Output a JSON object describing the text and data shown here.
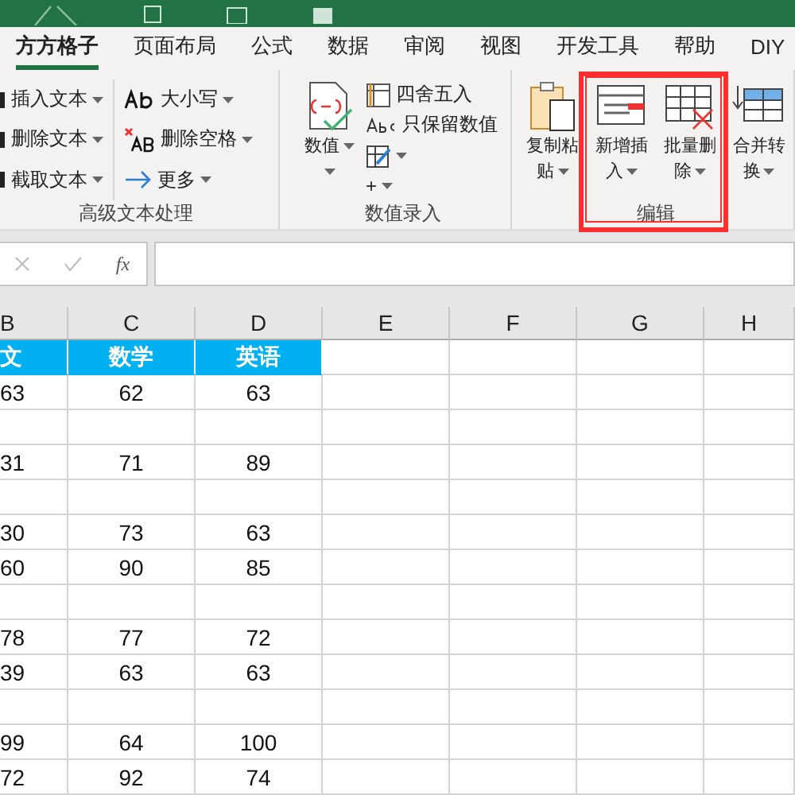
{
  "tabs": [
    {
      "label": "方方格子",
      "selected": true
    },
    {
      "label": "页面布局",
      "selected": false
    },
    {
      "label": "公式",
      "selected": false
    },
    {
      "label": "数据",
      "selected": false
    },
    {
      "label": "审阅",
      "selected": false
    },
    {
      "label": "视图",
      "selected": false
    },
    {
      "label": "开发工具",
      "selected": false
    },
    {
      "label": "帮助",
      "selected": false
    },
    {
      "label": "DIY",
      "selected": false
    }
  ],
  "ribbon": {
    "groups": [
      {
        "label": "高级文本处理",
        "columns": [
          [
            {
              "label": "插入文本",
              "kind": "cut"
            },
            {
              "label": "删除文本",
              "kind": "cut"
            },
            {
              "label": "截取文本",
              "kind": "cut"
            }
          ],
          [
            {
              "label": "大小写",
              "kind": "case"
            },
            {
              "label": "删除空格",
              "kind": "space"
            },
            {
              "label": "更多",
              "kind": "arrow"
            }
          ]
        ]
      },
      {
        "label": "数值录入",
        "large": [
          {
            "lines": [
              "数值"
            ],
            "kind": "value"
          }
        ],
        "columns": [
          [
            {
              "label": "四舍五入",
              "kind": "round",
              "dropdown": false
            },
            {
              "label": "只保留数值",
              "kind": "abc",
              "dropdown": false
            },
            {
              "kind": "gridpen",
              "dropdown": true
            },
            {
              "label": "+",
              "kind": "none",
              "dropdown": true
            }
          ]
        ]
      },
      {
        "label": "编辑",
        "large": [
          {
            "lines": [
              "复制粘",
              "贴"
            ],
            "kind": "paste"
          },
          {
            "lines": [
              "新增插",
              "入"
            ],
            "kind": "insert"
          },
          {
            "lines": [
              "批量删",
              "除"
            ],
            "kind": "delete"
          },
          {
            "lines": [
              "合并转",
              "换"
            ],
            "kind": "merge"
          }
        ]
      }
    ]
  },
  "formula_bar": {
    "function_label": "fx"
  },
  "sheet": {
    "columns": [
      "B",
      "C",
      "D",
      "E",
      "F",
      "G",
      "H"
    ],
    "rows": [
      {
        "kind": "header",
        "cells": [
          "文",
          "数学",
          "英语"
        ]
      },
      {
        "kind": "data",
        "cells": [
          "63",
          "62",
          "63"
        ]
      },
      {
        "kind": "data",
        "cells": []
      },
      {
        "kind": "data",
        "cells": [
          "31",
          "71",
          "89"
        ]
      },
      {
        "kind": "data",
        "cells": []
      },
      {
        "kind": "data",
        "cells": [
          "30",
          "73",
          "63"
        ]
      },
      {
        "kind": "data",
        "cells": [
          "60",
          "90",
          "85"
        ]
      },
      {
        "kind": "data",
        "cells": []
      },
      {
        "kind": "data",
        "cells": [
          "78",
          "77",
          "72"
        ]
      },
      {
        "kind": "data",
        "cells": [
          "39",
          "63",
          "63"
        ]
      },
      {
        "kind": "data",
        "cells": []
      },
      {
        "kind": "data",
        "cells": [
          "99",
          "64",
          "100"
        ]
      },
      {
        "kind": "data",
        "cells": [
          "72",
          "92",
          "74"
        ]
      }
    ]
  }
}
